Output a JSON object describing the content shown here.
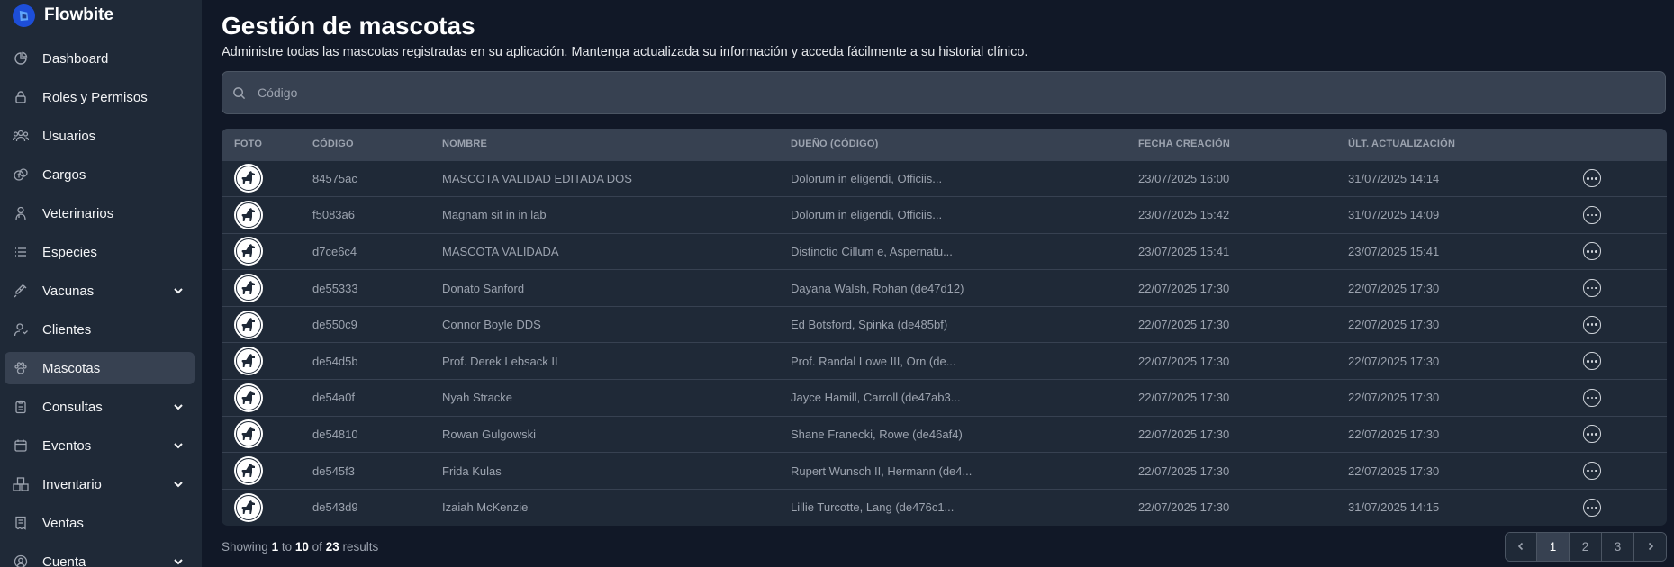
{
  "brand": {
    "name": "Flowbite"
  },
  "sidebar": {
    "items": [
      {
        "label": "Dashboard",
        "icon": "chart-pie-icon",
        "expandable": false,
        "active": false
      },
      {
        "label": "Roles y Permisos",
        "icon": "lock-icon",
        "expandable": false,
        "active": false
      },
      {
        "label": "Usuarios",
        "icon": "users-icon",
        "expandable": false,
        "active": false
      },
      {
        "label": "Cargos",
        "icon": "cash-icon",
        "expandable": false,
        "active": false
      },
      {
        "label": "Veterinarios",
        "icon": "doctor-icon",
        "expandable": false,
        "active": false
      },
      {
        "label": "Especies",
        "icon": "list-icon",
        "expandable": false,
        "active": false
      },
      {
        "label": "Vacunas",
        "icon": "syringe-icon",
        "expandable": true,
        "active": false
      },
      {
        "label": "Clientes",
        "icon": "user-icon",
        "expandable": false,
        "active": false
      },
      {
        "label": "Mascotas",
        "icon": "paw-icon",
        "expandable": false,
        "active": true
      },
      {
        "label": "Consultas",
        "icon": "clipboard-icon",
        "expandable": true,
        "active": false
      },
      {
        "label": "Eventos",
        "icon": "calendar-icon",
        "expandable": true,
        "active": false
      },
      {
        "label": "Inventario",
        "icon": "boxes-icon",
        "expandable": true,
        "active": false
      },
      {
        "label": "Ventas",
        "icon": "receipt-icon",
        "expandable": false,
        "active": false
      },
      {
        "label": "Cuenta",
        "icon": "user-circle-icon",
        "expandable": true,
        "active": false
      }
    ]
  },
  "page": {
    "title": "Gestión de mascotas",
    "subtitle": "Administre todas las mascotas registradas en su aplicación. Mantenga actualizada su información y acceda fácilmente a su historial clínico."
  },
  "search": {
    "placeholder": "Código",
    "value": ""
  },
  "table": {
    "headers": {
      "foto": "FOTO",
      "codigo": "CÓDIGO",
      "nombre": "NOMBRE",
      "dueno": "DUEÑO (CÓDIGO)",
      "creacion": "FECHA CREACIÓN",
      "actualizacion": "ÚLT. ACTUALIZACIÓN"
    },
    "rows": [
      {
        "codigo": "84575ac",
        "nombre": "MASCOTA VALIDAD EDITADA DOS",
        "dueno": "Dolorum in eligendi, Officiis...",
        "creacion": "23/07/2025 16:00",
        "actualizacion": "31/07/2025 14:14"
      },
      {
        "codigo": "f5083a6",
        "nombre": "Magnam sit in in lab",
        "dueno": "Dolorum in eligendi, Officiis...",
        "creacion": "23/07/2025 15:42",
        "actualizacion": "31/07/2025 14:09"
      },
      {
        "codigo": "d7ce6c4",
        "nombre": "MASCOTA VALIDADA",
        "dueno": "Distinctio Cillum e, Aspernatu...",
        "creacion": "23/07/2025 15:41",
        "actualizacion": "23/07/2025 15:41"
      },
      {
        "codigo": "de55333",
        "nombre": "Donato Sanford",
        "dueno": "Dayana Walsh, Rohan (de47d12)",
        "creacion": "22/07/2025 17:30",
        "actualizacion": "22/07/2025 17:30"
      },
      {
        "codigo": "de550c9",
        "nombre": "Connor Boyle DDS",
        "dueno": "Ed Botsford, Spinka (de485bf)",
        "creacion": "22/07/2025 17:30",
        "actualizacion": "22/07/2025 17:30"
      },
      {
        "codigo": "de54d5b",
        "nombre": "Prof. Derek Lebsack II",
        "dueno": "Prof. Randal Lowe III, Orn (de...",
        "creacion": "22/07/2025 17:30",
        "actualizacion": "22/07/2025 17:30"
      },
      {
        "codigo": "de54a0f",
        "nombre": "Nyah Stracke",
        "dueno": "Jayce Hamill, Carroll (de47ab3...",
        "creacion": "22/07/2025 17:30",
        "actualizacion": "22/07/2025 17:30"
      },
      {
        "codigo": "de54810",
        "nombre": "Rowan Gulgowski",
        "dueno": "Shane Franecki, Rowe (de46af4)",
        "creacion": "22/07/2025 17:30",
        "actualizacion": "22/07/2025 17:30"
      },
      {
        "codigo": "de545f3",
        "nombre": "Frida Kulas",
        "dueno": "Rupert Wunsch II, Hermann (de4...",
        "creacion": "22/07/2025 17:30",
        "actualizacion": "22/07/2025 17:30"
      },
      {
        "codigo": "de543d9",
        "nombre": "Izaiah McKenzie",
        "dueno": "Lillie Turcotte, Lang (de476c1...",
        "creacion": "22/07/2025 17:30",
        "actualizacion": "31/07/2025 14:15"
      }
    ]
  },
  "pagination": {
    "showing_prefix": "Showing",
    "from": "1",
    "to_word": "to",
    "to": "10",
    "of_word": "of",
    "total": "23",
    "suffix": "results",
    "pages": [
      "1",
      "2",
      "3"
    ],
    "current_page": "1"
  },
  "colors": {
    "background": "#111827",
    "sidebar": "#1f2937",
    "active_item": "#374151",
    "brand_blue": "#1d4ed8"
  }
}
